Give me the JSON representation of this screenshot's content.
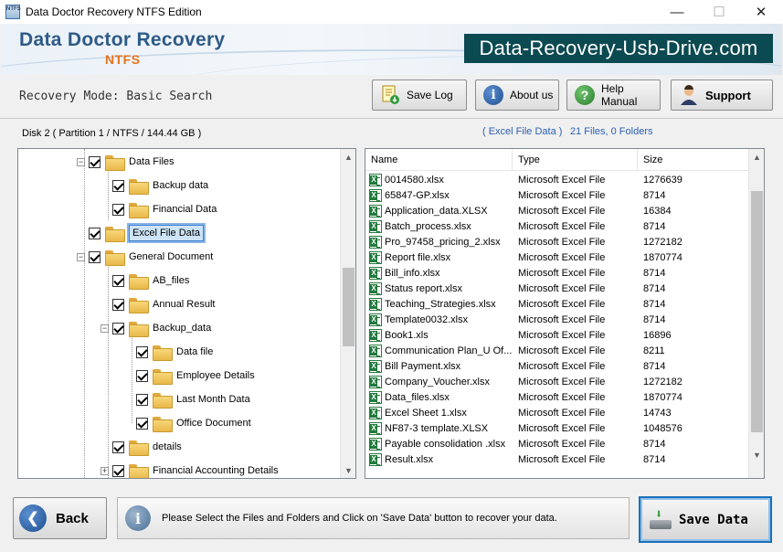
{
  "window": {
    "title": "Data Doctor Recovery NTFS Edition",
    "app_icon_text": "NTFS",
    "minimize": "—",
    "maximize": "☐",
    "close": "✕"
  },
  "banner": {
    "brand": "Data Doctor Recovery",
    "edition": "NTFS",
    "website": "Data-Recovery-Usb-Drive.com"
  },
  "toolbar": {
    "mode_label": "Recovery Mode: Basic Search",
    "save_log": "Save Log",
    "about_us": "About us",
    "help_manual": "Help Manual",
    "support": "Support"
  },
  "disk_label": "Disk 2 ( Partition 1 / NTFS / 144.44 GB )",
  "summary": {
    "folder": "( Excel File Data )",
    "counts": "21 Files, 0 Folders"
  },
  "tree": [
    {
      "label": "Data Files",
      "level": 0,
      "expander": "−"
    },
    {
      "label": "Backup data",
      "level": 1
    },
    {
      "label": "Financial Data",
      "level": 1
    },
    {
      "label": "Excel File Data",
      "level": 0,
      "selected": true
    },
    {
      "label": "General Document",
      "level": 0,
      "expander": "−"
    },
    {
      "label": "AB_files",
      "level": 1
    },
    {
      "label": "Annual Result",
      "level": 1
    },
    {
      "label": "Backup_data",
      "level": 1,
      "expander": "−"
    },
    {
      "label": "Data file",
      "level": 2
    },
    {
      "label": "Employee Details",
      "level": 2
    },
    {
      "label": "Last Month Data",
      "level": 2
    },
    {
      "label": "Office Document",
      "level": 2
    },
    {
      "label": "details",
      "level": 1
    },
    {
      "label": "Financial Accounting Details",
      "level": 1,
      "expander": "+"
    }
  ],
  "scroll_arrows": {
    "up": "▲",
    "down": "▼"
  },
  "file_list": {
    "columns": [
      "Name",
      "Type",
      "Size"
    ],
    "rows": [
      [
        "0014580.xlsx",
        "Microsoft Excel File",
        "1276639"
      ],
      [
        "65847-GP.xlsx",
        "Microsoft Excel File",
        "8714"
      ],
      [
        "Application_data.XLSX",
        "Microsoft Excel File",
        "16384"
      ],
      [
        "Batch_process.xlsx",
        "Microsoft Excel File",
        "8714"
      ],
      [
        "Pro_97458_pricing_2.xlsx",
        "Microsoft Excel File",
        "1272182"
      ],
      [
        "Report file.xlsx",
        "Microsoft Excel File",
        "1870774"
      ],
      [
        "Bill_info.xlsx",
        "Microsoft Excel File",
        "8714"
      ],
      [
        "Status report.xlsx",
        "Microsoft Excel File",
        "8714"
      ],
      [
        "Teaching_Strategies.xlsx",
        "Microsoft Excel File",
        "8714"
      ],
      [
        "Template0032.xlsx",
        "Microsoft Excel File",
        "8714"
      ],
      [
        "Book1.xls",
        "Microsoft Excel File",
        "16896"
      ],
      [
        "Communication Plan_U Of...",
        "Microsoft Excel File",
        "8211"
      ],
      [
        "Bill Payment.xlsx",
        "Microsoft Excel File",
        "8714"
      ],
      [
        "Company_Voucher.xlsx",
        "Microsoft Excel File",
        "1272182"
      ],
      [
        "Data_files.xlsx",
        "Microsoft Excel File",
        "1870774"
      ],
      [
        "Excel Sheet 1.xlsx",
        "Microsoft Excel File",
        "14743"
      ],
      [
        "NF87-3 template.XLSX",
        "Microsoft Excel File",
        "1048576"
      ],
      [
        "Payable consolidation .xlsx",
        "Microsoft Excel File",
        "8714"
      ],
      [
        "Result.xlsx",
        "Microsoft Excel File",
        "8714"
      ]
    ]
  },
  "bottom": {
    "back": "Back",
    "back_icon": "❮",
    "info_icon": "i",
    "info_text": "Please Select the Files and Folders and Click on 'Save Data' button to recover your data.",
    "save_data": "Save Data"
  }
}
